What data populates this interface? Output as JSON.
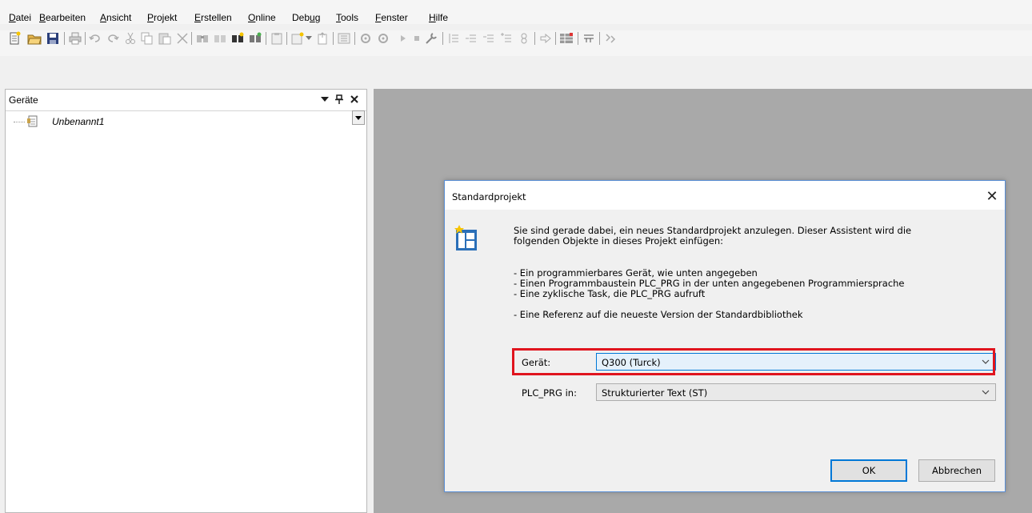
{
  "menu": {
    "items": [
      {
        "pre": "",
        "u": "D",
        "post": "atei"
      },
      {
        "pre": "",
        "u": "B",
        "post": "earbeiten"
      },
      {
        "pre": "",
        "u": "A",
        "post": "nsicht"
      },
      {
        "pre": "",
        "u": "P",
        "post": "rojekt"
      },
      {
        "pre": "",
        "u": "E",
        "post": "rstellen"
      },
      {
        "pre": "",
        "u": "O",
        "post": "nline"
      },
      {
        "pre": "Deb",
        "u": "u",
        "post": "g"
      },
      {
        "pre": "",
        "u": "T",
        "post": "ools"
      },
      {
        "pre": "",
        "u": "F",
        "post": "enster"
      },
      {
        "pre": "",
        "u": "H",
        "post": "ilfe"
      }
    ]
  },
  "toolbar": {
    "icons": [
      "new-project-icon",
      "open-folder-icon",
      "save-icon",
      "print-icon",
      "undo-icon",
      "redo-icon",
      "cut-icon",
      "copy-icon",
      "paste-icon",
      "delete-icon",
      "find-icon",
      "find-next-icon",
      "find-highlight-icon",
      "replace-icon",
      "clipboard-icon",
      "add-object-icon",
      "upload-icon",
      "library-icon",
      "build-icon",
      "rebuild-icon",
      "run-icon",
      "stop-icon",
      "tool-icon",
      "step-into-icon",
      "step-over-icon",
      "step-out-icon",
      "breakpoint-icon",
      "settings-icon",
      "arrow-right-icon",
      "grid-icon",
      "filter-icon",
      "compare-icon"
    ]
  },
  "devices_pane": {
    "title": "Geräte",
    "tree": [
      {
        "label": "Unbenannt1",
        "icon": "project-icon"
      }
    ]
  },
  "dialog": {
    "title": "Standardprojekt",
    "intro_line1": "Sie sind gerade dabei, ein neues Standardprojekt anzulegen. Dieser Assistent wird die",
    "intro_line2": "folgenden Objekte in dieses Projekt einfügen:",
    "bullets": [
      "- Ein programmierbares Gerät, wie unten angegeben",
      "- Einen Programmbaustein PLC_PRG in der unten angegebenen Programmiersprache",
      "- Eine zyklische Task, die PLC_PRG aufruft",
      "- Eine Referenz auf die neueste Version der Standardbibliothek"
    ],
    "device_label": "Gerät:",
    "device_value": "Q300 (Turck)",
    "plc_label": "PLC_PRG in:",
    "plc_value": "Strukturierter Text (ST)",
    "ok_label": "OK",
    "cancel_label": "Abbrechen",
    "highlight_color": "#e0141e",
    "accent_color": "#0078d7"
  }
}
